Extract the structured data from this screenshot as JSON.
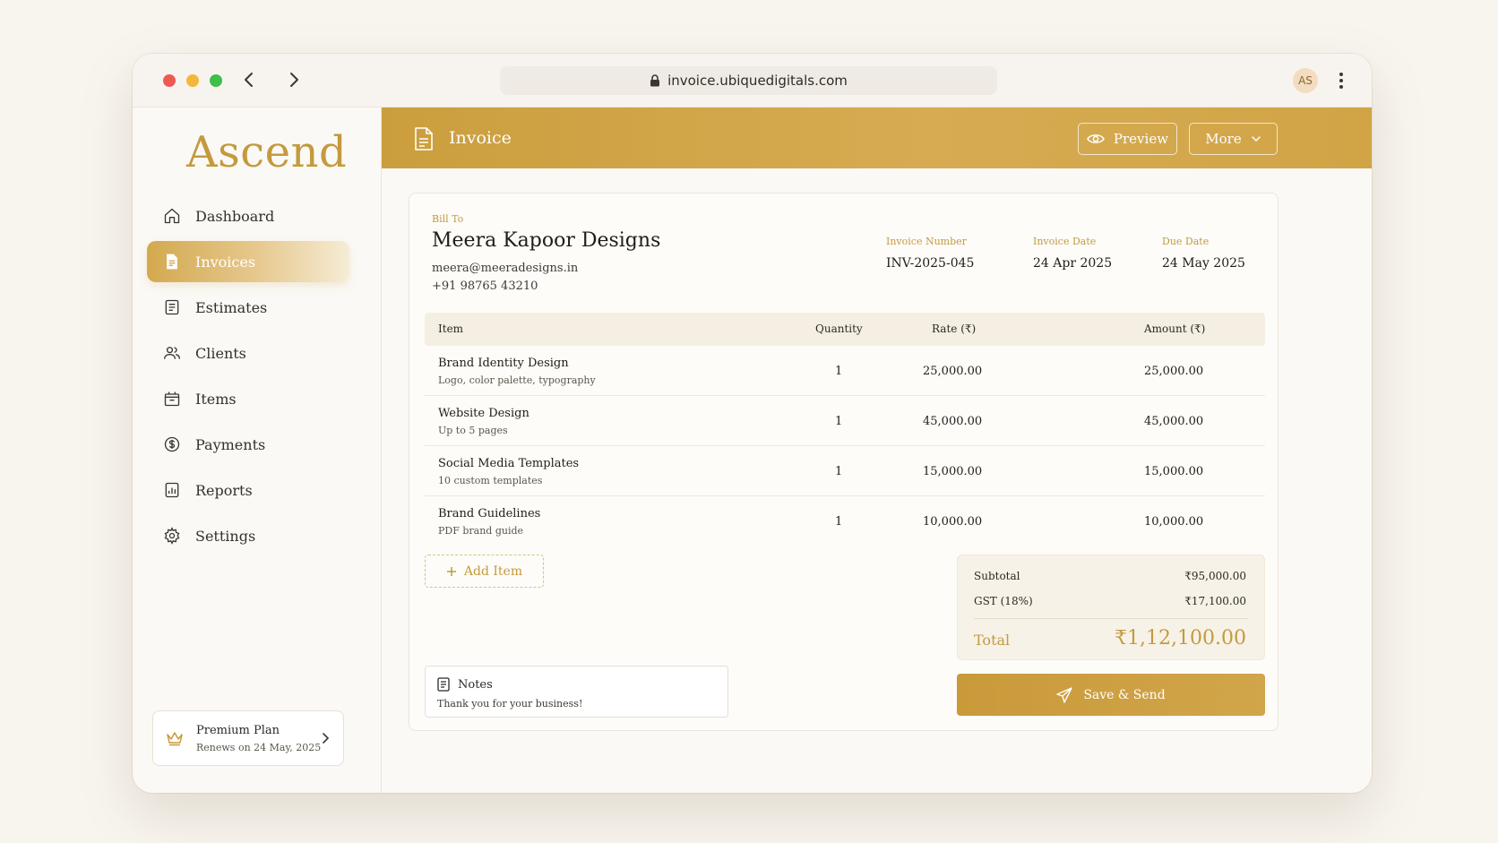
{
  "browser": {
    "url": "invoice.ubiquedigitals.com",
    "avatar_initials": "AS"
  },
  "sidebar": {
    "logo": "Ascend",
    "items": [
      {
        "label": "Dashboard",
        "icon": "home-icon"
      },
      {
        "label": "Invoices",
        "icon": "invoice-icon",
        "active": true
      },
      {
        "label": "Estimates",
        "icon": "estimate-icon"
      },
      {
        "label": "Clients",
        "icon": "users-icon"
      },
      {
        "label": "Items",
        "icon": "box-icon"
      },
      {
        "label": "Payments",
        "icon": "dollar-icon"
      },
      {
        "label": "Reports",
        "icon": "chart-icon"
      },
      {
        "label": "Settings",
        "icon": "gear-icon"
      }
    ],
    "premium": {
      "title": "Premium Plan",
      "subtitle": "Renews on 24 May, 2025"
    }
  },
  "header": {
    "title": "Invoice",
    "preview_label": "Preview",
    "more_label": "More"
  },
  "invoice": {
    "bill_to_label": "Bill To",
    "client_name": "Meera Kapoor Designs",
    "client_email": "meera@meeradesigns.in",
    "client_phone": "+91 98765 43210",
    "meta": [
      {
        "label": "Invoice Number",
        "value": "INV-2025-045"
      },
      {
        "label": "Invoice Date",
        "value": "24 Apr 2025"
      },
      {
        "label": "Due Date",
        "value": "24 May 2025"
      }
    ],
    "columns": {
      "item": "Item",
      "quantity": "Quantity",
      "rate": "Rate (₹)",
      "amount": "Amount (₹)"
    },
    "rows": [
      {
        "name": "Brand Identity Design",
        "desc": "Logo, color palette, typography",
        "qty": "1",
        "rate": "25,000.00",
        "amount": "25,000.00"
      },
      {
        "name": "Website Design",
        "desc": "Up to 5 pages",
        "qty": "1",
        "rate": "45,000.00",
        "amount": "45,000.00"
      },
      {
        "name": "Social Media Templates",
        "desc": "10 custom templates",
        "qty": "1",
        "rate": "15,000.00",
        "amount": "15,000.00"
      },
      {
        "name": "Brand Guidelines",
        "desc": "PDF brand guide",
        "qty": "1",
        "rate": "10,000.00",
        "amount": "10,000.00"
      }
    ],
    "add_item_label": "Add Item",
    "totals": {
      "subtotal_label": "Subtotal",
      "subtotal": "₹95,000.00",
      "gst_label": "GST (18%)",
      "gst": "₹17,100.00",
      "total_label": "Total",
      "total": "₹1,12,100.00"
    },
    "notes_label": "Notes",
    "notes_text": "Thank you for your business!",
    "save_label": "Save & Send"
  },
  "colors": {
    "accent": "#c99a3a",
    "background": "#f8f5ef"
  }
}
